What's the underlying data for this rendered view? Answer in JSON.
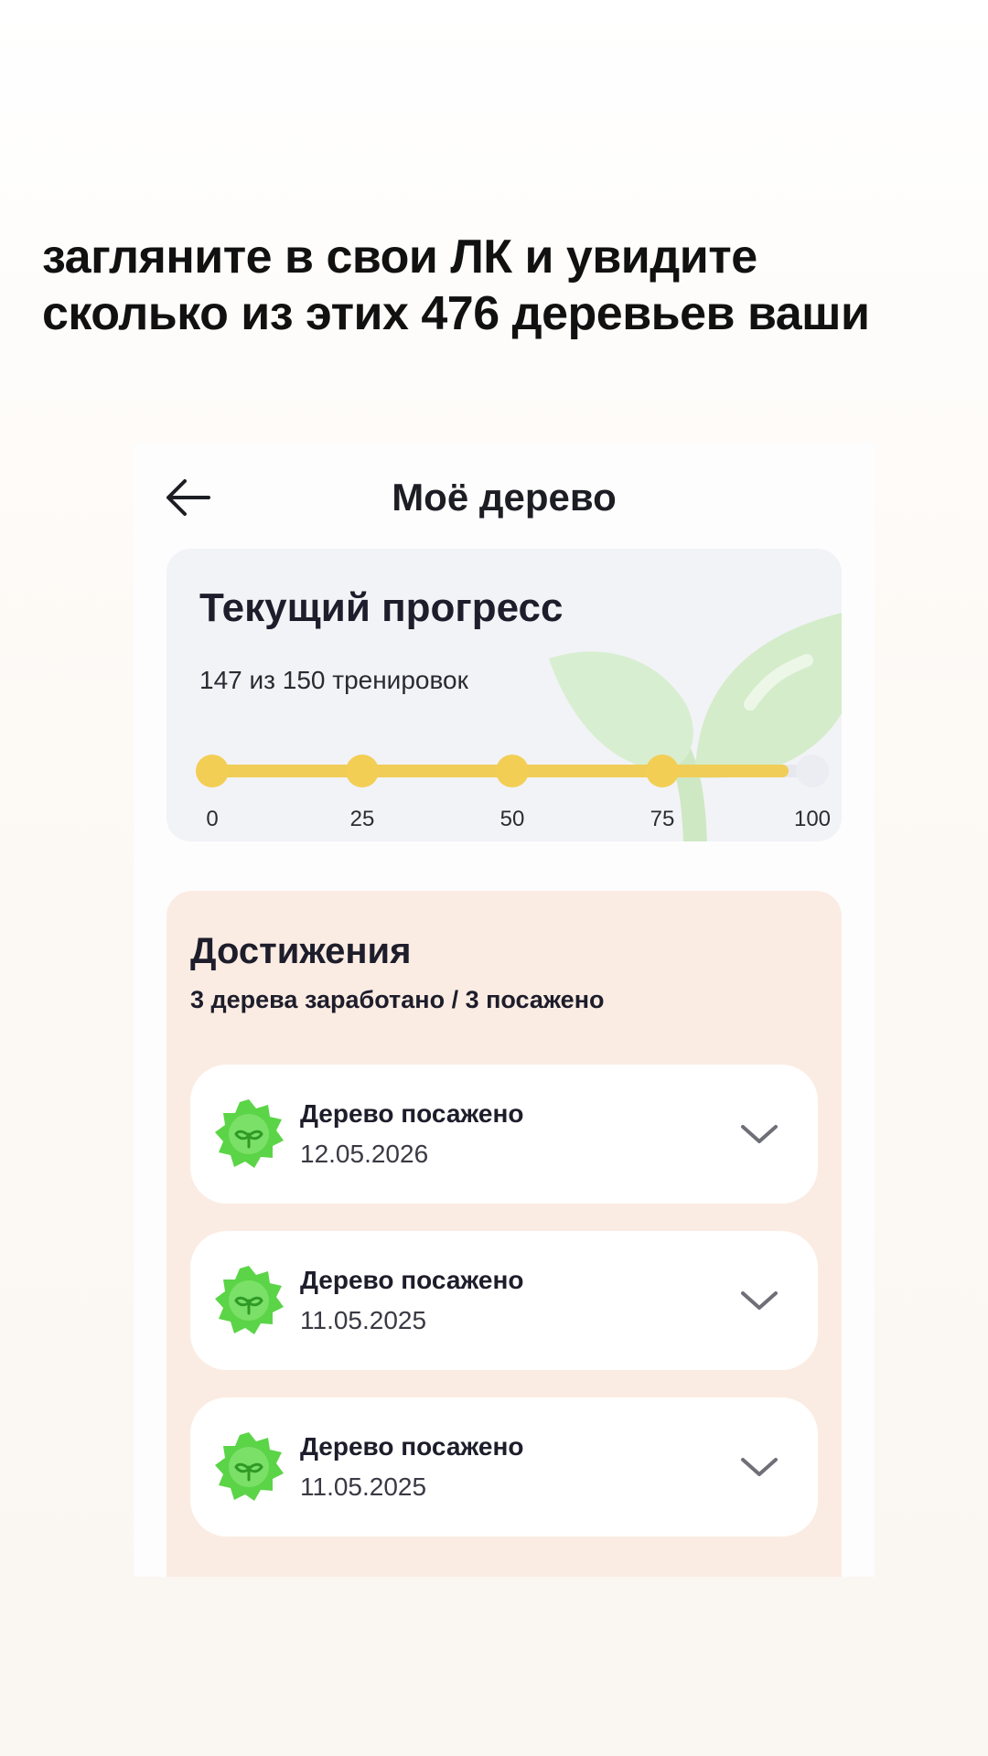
{
  "headline": {
    "line1": "загляните в свои ЛК и увидите",
    "line2": "сколько из этих 476 деревьев ваши"
  },
  "screen": {
    "title": "Моё дерево",
    "back_icon": "arrow-left-icon"
  },
  "progress": {
    "title": "Текущий прогресс",
    "subtitle": "147 из 150 тренировок",
    "filled_percent": 96,
    "milestones": [
      {
        "label": "0",
        "value": 0,
        "reached": true
      },
      {
        "label": "25",
        "value": 25,
        "reached": true
      },
      {
        "label": "50",
        "value": 50,
        "reached": true
      },
      {
        "label": "75",
        "value": 75,
        "reached": true
      },
      {
        "label": "100",
        "value": 100,
        "reached": false
      }
    ]
  },
  "achievements": {
    "title": "Достижения",
    "subtitle": "3 дерева заработано / 3 посажено",
    "items": [
      {
        "title": "Дерево посажено",
        "date": "12.05.2026",
        "icon": "sprout-badge-icon"
      },
      {
        "title": "Дерево посажено",
        "date": "11.05.2025",
        "icon": "sprout-badge-icon"
      },
      {
        "title": "Дерево посажено",
        "date": "11.05.2025",
        "icon": "sprout-badge-icon"
      }
    ]
  },
  "colors": {
    "accent_yellow": "#f3ce55",
    "badge_green": "#5bd447",
    "achievements_bg": "#fbece3",
    "progress_bg": "#f2f3f7"
  }
}
